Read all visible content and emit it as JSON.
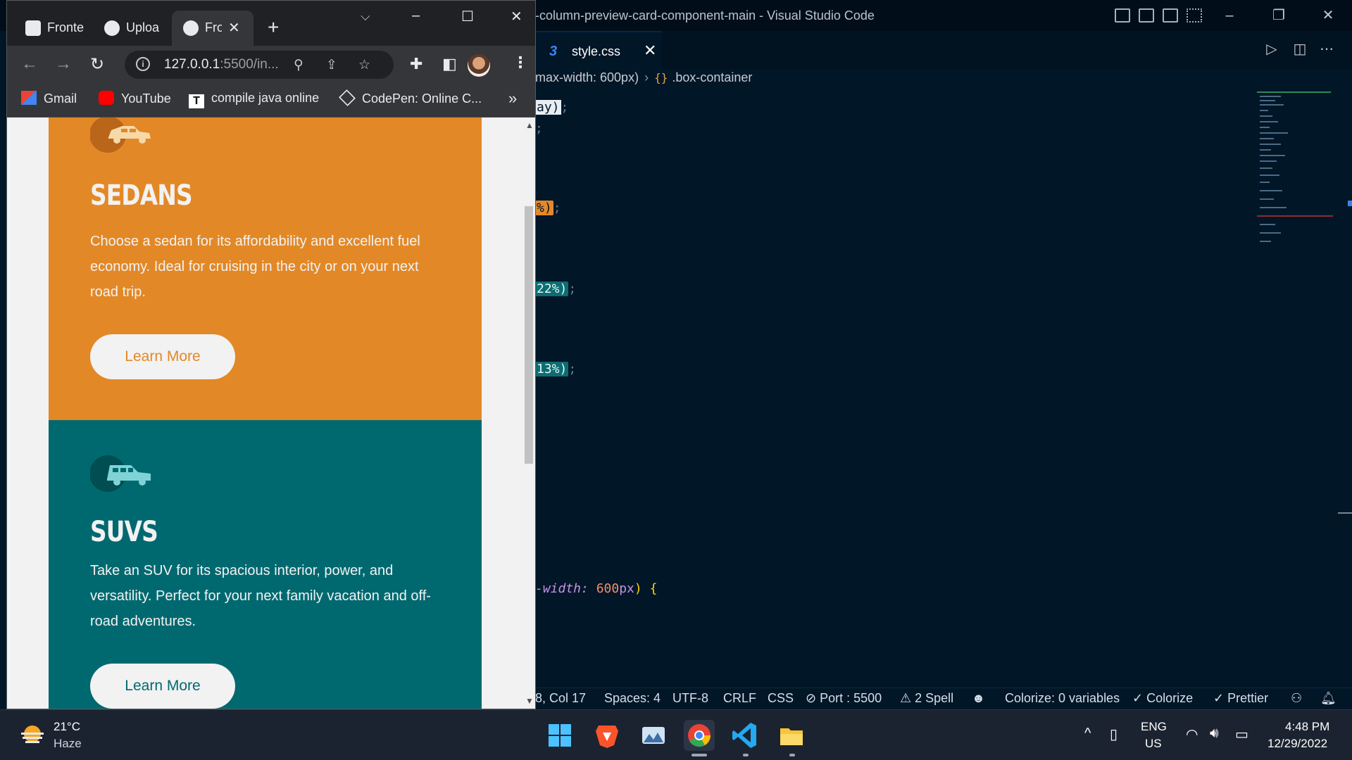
{
  "vscode": {
    "window_title": "-column-preview-card-component-main - Visual Studio Code",
    "tab": {
      "icon": "css-file-icon",
      "label": "style.css"
    },
    "breadcrumb": {
      "first": "max-width: 600px)",
      "second": ".box-container"
    },
    "code_lines": [
      {
        "text": "ay)",
        "suffix": ";"
      },
      {
        "text": ";"
      },
      {
        "text": "%)",
        "suffix": ";"
      },
      {
        "text": "22%)",
        "suffix": ";"
      },
      {
        "text": "13%)",
        "suffix": ";"
      },
      {
        "prefix": "-width: ",
        "num": "600",
        "unit": "px",
        "end": ") {"
      }
    ],
    "status": {
      "position": "8, Col 17",
      "spaces": "Spaces: 4",
      "encoding": "UTF-8",
      "eol": "CRLF",
      "language": "CSS",
      "port": "Port : 5500",
      "spell": "2 Spell",
      "colorize_vars": "Colorize: 0 variables",
      "colorize": "Colorize",
      "prettier": "Prettier"
    }
  },
  "chrome": {
    "tabs": [
      {
        "label": "Fronte"
      },
      {
        "label": "Uploa"
      },
      {
        "label": "Fro"
      }
    ],
    "url": {
      "host": "127.0.0.1",
      "rest": ":5500/in..."
    },
    "bookmarks": [
      {
        "label": "Gmail",
        "icon": "gmail-icon"
      },
      {
        "label": "YouTube",
        "icon": "youtube-icon"
      },
      {
        "label": "compile java online",
        "icon": "t-icon"
      },
      {
        "label": "CodePen: Online C...",
        "icon": "codepen-icon"
      }
    ],
    "more_bookmarks": "»"
  },
  "page": {
    "cards": [
      {
        "title": "SEDANS",
        "description": "Choose a sedan for its affordability and excellent fuel economy. Ideal for cruising in the city or on your next road trip.",
        "button": "Learn More",
        "color": "#e38826"
      },
      {
        "title": "SUVS",
        "description": "Take an SUV for its spacious interior, power, and versatility. Perfect for your next family vacation and off-road adventures.",
        "button": "Learn More",
        "color": "#006970"
      }
    ]
  },
  "taskbar": {
    "weather": {
      "temp": "21°C",
      "condition": "Haze"
    },
    "lang": {
      "line1": "ENG",
      "line2": "US"
    },
    "clock": {
      "time": "4:48 PM",
      "date": "12/29/2022"
    }
  }
}
